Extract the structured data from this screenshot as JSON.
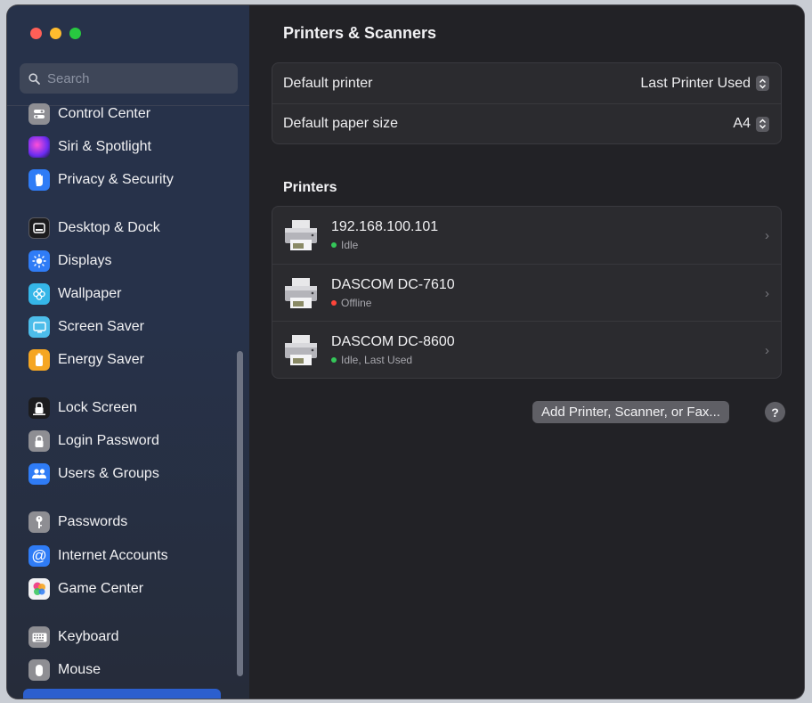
{
  "window": {
    "traffic_lights": [
      "close",
      "minimize",
      "maximize"
    ]
  },
  "search": {
    "placeholder": "Search",
    "value": ""
  },
  "sidebar": {
    "items": [
      {
        "label": "Control Center",
        "icon": "control-center-icon",
        "color": "#8e8e93"
      },
      {
        "label": "Siri & Spotlight",
        "icon": "siri-icon",
        "color": "#8a3ffc"
      },
      {
        "label": "Privacy & Security",
        "icon": "hand-icon",
        "color": "#2f7cf6"
      },
      {
        "label": "Desktop & Dock",
        "icon": "dock-icon",
        "color": "#1c1c1e"
      },
      {
        "label": "Displays",
        "icon": "sun-icon",
        "color": "#2f7cf6"
      },
      {
        "label": "Wallpaper",
        "icon": "flower-icon",
        "color": "#35b6e8"
      },
      {
        "label": "Screen Saver",
        "icon": "screen-saver-icon",
        "color": "#4dbdea"
      },
      {
        "label": "Energy Saver",
        "icon": "battery-icon",
        "color": "#f5a623"
      },
      {
        "label": "Lock Screen",
        "icon": "lock-icon",
        "color": "#1c1c1e"
      },
      {
        "label": "Login Password",
        "icon": "padlock-icon",
        "color": "#8e8e93"
      },
      {
        "label": "Users & Groups",
        "icon": "users-icon",
        "color": "#2f7cf6"
      },
      {
        "label": "Passwords",
        "icon": "key-icon",
        "color": "#8e8e93"
      },
      {
        "label": "Internet Accounts",
        "icon": "at-icon",
        "color": "#2f7cf6"
      },
      {
        "label": "Game Center",
        "icon": "game-center-icon",
        "color": "#e94b8a"
      },
      {
        "label": "Keyboard",
        "icon": "keyboard-icon",
        "color": "#8e8e93"
      },
      {
        "label": "Mouse",
        "icon": "mouse-icon",
        "color": "#8e8e93"
      }
    ]
  },
  "main": {
    "title": "Printers & Scanners",
    "defaults": [
      {
        "label": "Default printer",
        "value": "Last Printer Used"
      },
      {
        "label": "Default paper size",
        "value": "A4"
      }
    ],
    "printers_title": "Printers",
    "printers": [
      {
        "name": "192.168.100.101",
        "status": "Idle",
        "status_color": "#34c759"
      },
      {
        "name": "DASCOM DC-7610",
        "status": "Offline",
        "status_color": "#ff453a"
      },
      {
        "name": "DASCOM DC-8600",
        "status": "Idle, Last Used",
        "status_color": "#34c759"
      }
    ],
    "add_button": "Add Printer, Scanner, or Fax...",
    "help_button": "?"
  }
}
